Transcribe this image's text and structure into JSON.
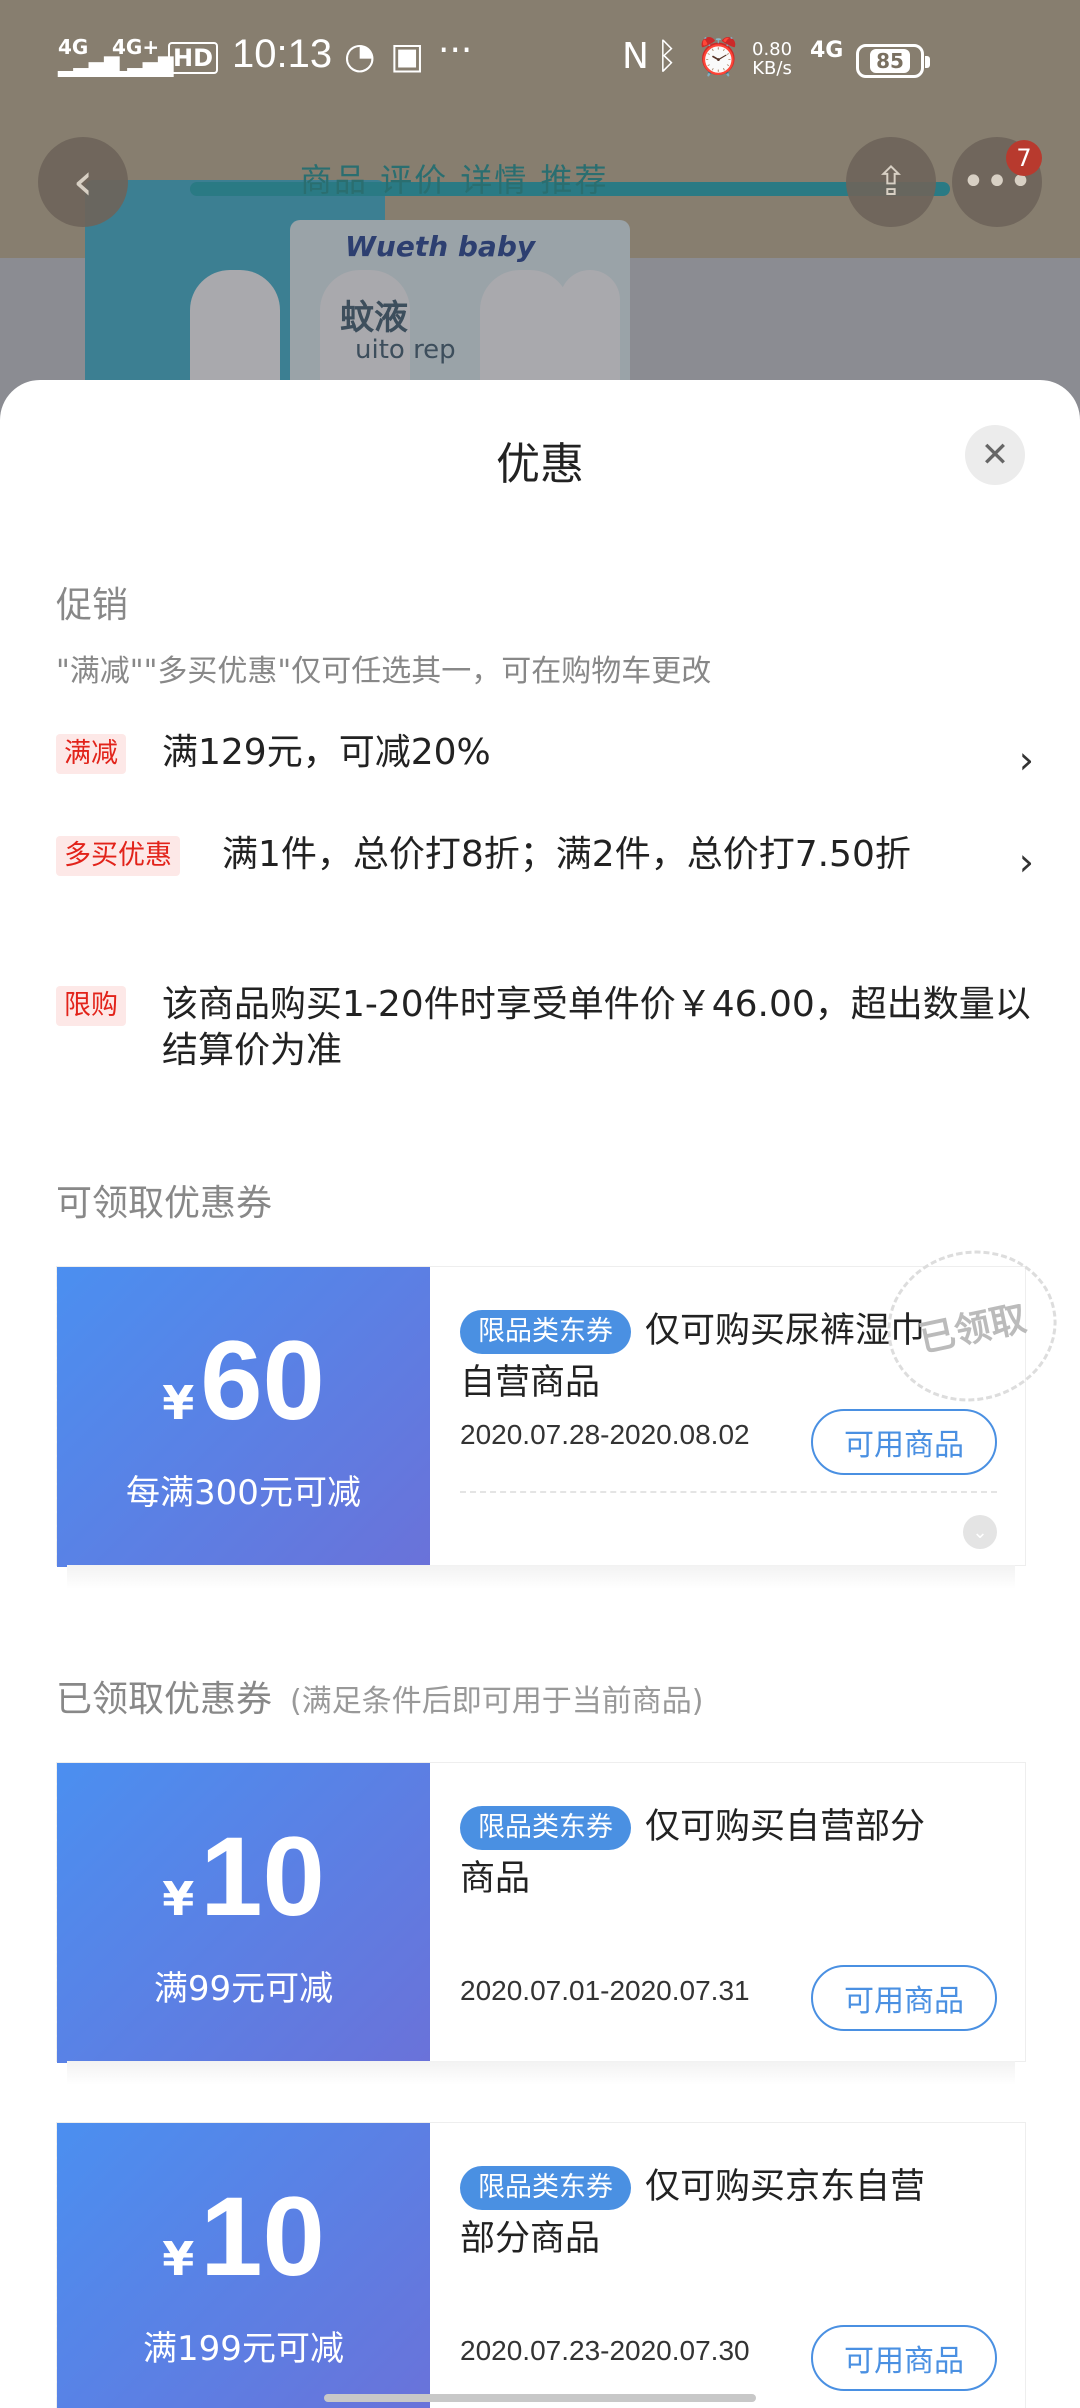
{
  "status_bar": {
    "signal1": "4G",
    "signal2": "4G+",
    "hd": "HD",
    "time": "10:13",
    "speed_value": "0.80",
    "speed_unit": "KB/s",
    "network": "4G",
    "battery": "85"
  },
  "background_page": {
    "tabs": "商品  评价  详情  推荐",
    "brand": "Wueth baby",
    "product_label": "蚊液",
    "product_sub": "uito rep",
    "more_badge": "7"
  },
  "sheet": {
    "title": "优惠",
    "close_label": "✕"
  },
  "promotions": {
    "section_title": "促销",
    "note": "\"满减\"\"多买优惠\"仅可任选其一，可在购物车更改",
    "items": [
      {
        "tag": "满减",
        "text": "满129元，可减20%"
      },
      {
        "tag": "多买优惠",
        "text": "满1件，总价打8折；满2件，总价打7.50折"
      },
      {
        "tag": "限购",
        "text": "该商品购买1-20件时享受单件价￥46.00，超出数量以结算价为准"
      }
    ]
  },
  "available_coupons": {
    "section_title": "可领取优惠券",
    "items": [
      {
        "yen": "¥",
        "amount": "60",
        "condition": "每满300元可减",
        "category": "限品类东券",
        "desc": "仅可购买尿裤湿巾自营商品",
        "date": "2020.07.28-2020.08.02",
        "button": "可用商品",
        "stamp": "已领取"
      }
    ]
  },
  "claimed_coupons": {
    "section_title": "已领取优惠券",
    "section_sub": "(满足条件后即可用于当前商品)",
    "items": [
      {
        "yen": "¥",
        "amount": "10",
        "condition": "满99元可减",
        "category": "限品类东券",
        "desc": "仅可购买自营部分商品",
        "date": "2020.07.01-2020.07.31",
        "button": "可用商品"
      },
      {
        "yen": "¥",
        "amount": "10",
        "condition": "满199元可减",
        "category": "限品类东券",
        "desc": "仅可购买京东自营部分商品",
        "date": "2020.07.23-2020.07.30",
        "button": "可用商品"
      }
    ]
  },
  "colors": {
    "accent_red": "#e2231a",
    "coupon_gradient_start": "#4b8ff0",
    "coupon_gradient_end": "#6a72d9",
    "link_blue": "#4a90e2"
  }
}
